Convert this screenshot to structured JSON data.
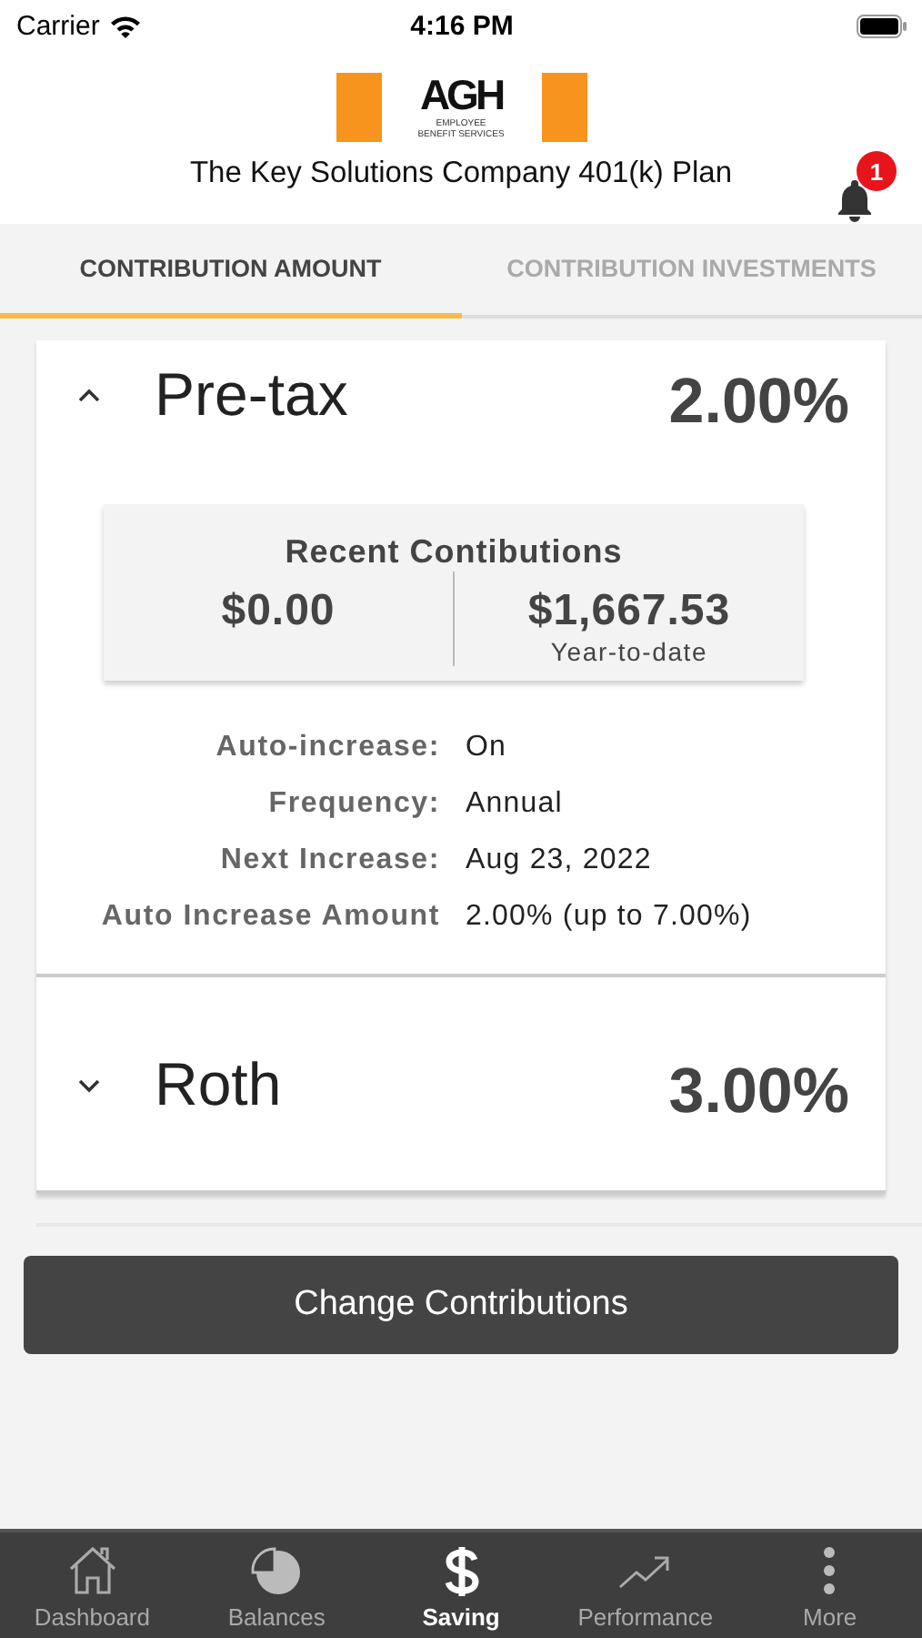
{
  "status_bar": {
    "carrier": "Carrier",
    "time": "4:16 PM"
  },
  "header": {
    "logo": {
      "name": "AGH",
      "tagline": "EMPLOYEE BENEFIT SERVICES"
    },
    "plan_title": "The Key Solutions Company 401(k) Plan",
    "notification_count": "1"
  },
  "tabs": [
    {
      "label": "CONTRIBUTION AMOUNT",
      "selected": true
    },
    {
      "label": "CONTRIBUTION INVESTMENTS",
      "selected": false
    }
  ],
  "sources": [
    {
      "name": "Pre-tax",
      "rate": "2.00%",
      "expanded": true,
      "recent": {
        "title": "Recent Contibutions",
        "amount": "$0.00",
        "ytd_amount": "$1,667.53",
        "ytd_label": "Year-to-date"
      },
      "details": [
        {
          "label": "Auto-increase:",
          "value": "On"
        },
        {
          "label": "Frequency:",
          "value": "Annual"
        },
        {
          "label": "Next Increase:",
          "value": "Aug 23, 2022"
        },
        {
          "label": "Auto Increase Amount",
          "value": "2.00% (up to 7.00%)"
        }
      ]
    },
    {
      "name": "Roth",
      "rate": "3.00%",
      "expanded": false
    }
  ],
  "action_button": "Change Contributions",
  "tab_bar": [
    {
      "label": "Dashboard",
      "selected": false
    },
    {
      "label": "Balances",
      "selected": false
    },
    {
      "label": "Saving",
      "selected": true
    },
    {
      "label": "Performance",
      "selected": false
    },
    {
      "label": "More",
      "selected": false
    }
  ]
}
